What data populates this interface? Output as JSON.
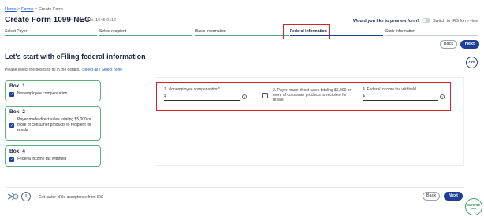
{
  "breadcrumb": {
    "home": "Home",
    "sep1": " > ",
    "forms": "Forms",
    "sep2": " > ",
    "current": "Create Form"
  },
  "header": {
    "title": "Create Form 1099-NEC",
    "omb": "OMB No. 1545-0116",
    "preview_question": "Would you like to preview form?",
    "toggle_label": "Switch to IRS form view",
    "toggle_on": false
  },
  "steps": [
    {
      "label": "Select Payer",
      "state": "done"
    },
    {
      "label": "Select recipient",
      "state": "done"
    },
    {
      "label": "Basic Information",
      "state": "done"
    },
    {
      "label": "Federal information",
      "state": "active"
    },
    {
      "label": "State information",
      "state": "pending"
    }
  ],
  "nav": {
    "back_label": "Back",
    "next_label": "Next"
  },
  "progress": {
    "label": "75%",
    "value": 75
  },
  "main": {
    "heading": "Let's start with eFiling federal information",
    "instruction": "Please select the boxes to fill in the details.",
    "select_all": "Select all",
    "slash": " / ",
    "select_none": "Select none"
  },
  "boxes": [
    {
      "title": "Box: 1",
      "text": "Nonemployee compensation",
      "checked": true
    },
    {
      "title": "Box: 2",
      "text": "Payer made direct sales totaling $5,000 or more of consumer products to recipient for resale",
      "checked": true
    },
    {
      "title": "Box: 4",
      "text": "Federal income tax withheld",
      "checked": true
    }
  ],
  "fields": {
    "f1_label": "1. Nonemployee compensation*",
    "f1_prefix": "$",
    "f2_label": "2. Payer made direct sales totaling $5,000 or more of consumer products to recipient for resale",
    "f2_checked": false,
    "f4_label": "4. Federal income tax withheld",
    "f4_prefix": "$"
  },
  "footer": {
    "text": "Get faster eFile acceptance from IRS"
  },
  "badge": {
    "line1": "CERTIFIED",
    "line2": "IRIS"
  },
  "colors": {
    "primary": "#1d3f96",
    "success": "#5fb37a",
    "highlight": "#d4232a"
  }
}
